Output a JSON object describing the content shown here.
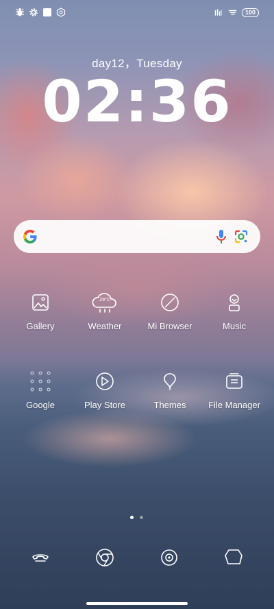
{
  "status_bar": {
    "left_icons": [
      "bug-icon",
      "settings-gear-icon",
      "square-icon",
      "app-badge-icon"
    ],
    "right_icons": [
      "signal-bars-icon",
      "wifi-icon"
    ],
    "battery": "100"
  },
  "lock": {
    "date": "day12，Tuesday",
    "time": "02:36"
  },
  "search": {
    "icons": [
      "google-g-icon",
      "microphone-icon",
      "google-lens-icon"
    ]
  },
  "apps": {
    "row1": [
      {
        "label": "Gallery",
        "icon": "gallery-icon"
      },
      {
        "label": "Weather",
        "icon": "weather-icon",
        "temp": "29°C"
      },
      {
        "label": "Mi Browser",
        "icon": "browser-icon"
      },
      {
        "label": "Music",
        "icon": "music-icon"
      }
    ],
    "row2": [
      {
        "label": "Google",
        "icon": "google-folder-icon"
      },
      {
        "label": "Play Store",
        "icon": "play-store-icon"
      },
      {
        "label": "Themes",
        "icon": "themes-icon"
      },
      {
        "label": "File Manager",
        "icon": "file-manager-icon"
      }
    ]
  },
  "page_indicator": {
    "pages": 2,
    "active": 1
  },
  "dock": [
    {
      "icon": "phone-icon"
    },
    {
      "icon": "chrome-icon"
    },
    {
      "icon": "camera-icon"
    },
    {
      "icon": "messages-icon"
    }
  ],
  "colors": {
    "google_blue": "#4285F4",
    "google_red": "#EA4335",
    "google_yellow": "#FBBC05",
    "google_green": "#34A853"
  }
}
